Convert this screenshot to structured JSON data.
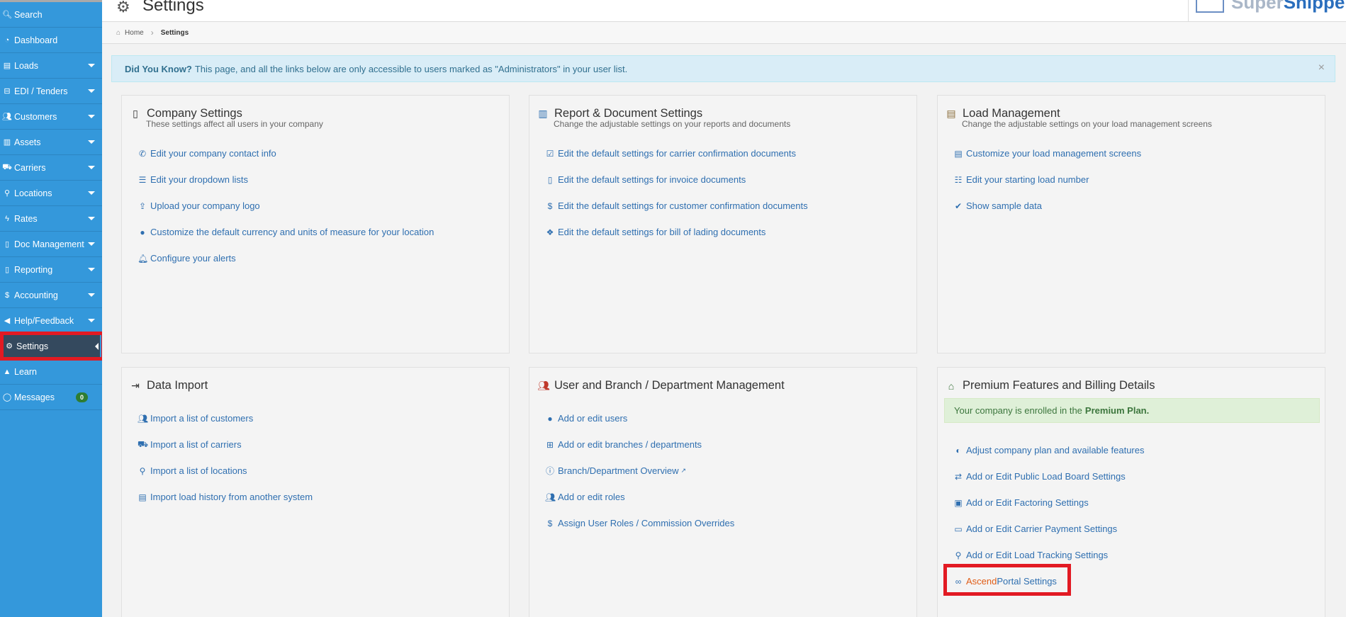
{
  "sidebar": {
    "items": [
      {
        "label": "Search",
        "icon": "search-icon",
        "glyph": "🔍︎"
      },
      {
        "label": "Dashboard",
        "icon": "dashboard-icon",
        "glyph": "◔"
      },
      {
        "label": "Loads",
        "icon": "list-icon",
        "glyph": "▤"
      },
      {
        "label": "EDI / Tenders",
        "icon": "inbox-icon",
        "glyph": "⊟"
      },
      {
        "label": "Customers",
        "icon": "users-icon",
        "glyph": "👥︎"
      },
      {
        "label": "Assets",
        "icon": "barcode-icon",
        "glyph": "▥"
      },
      {
        "label": "Carriers",
        "icon": "truck-icon",
        "glyph": "⛟"
      },
      {
        "label": "Locations",
        "icon": "map-marker-icon",
        "glyph": "⚲"
      },
      {
        "label": "Rates",
        "icon": "bolt-icon",
        "glyph": "ϟ"
      },
      {
        "label": "Doc Management",
        "icon": "document-icon",
        "glyph": "▯"
      },
      {
        "label": "Reporting",
        "icon": "report-icon",
        "glyph": "▯"
      },
      {
        "label": "Accounting",
        "icon": "dollar-icon",
        "glyph": "$"
      },
      {
        "label": "Help/Feedback",
        "icon": "bullhorn-icon",
        "glyph": "◀"
      },
      {
        "label": "Settings",
        "icon": "cogs-icon",
        "glyph": "⚙"
      },
      {
        "label": "Learn",
        "icon": "graduation-cap-icon",
        "glyph": "▲"
      },
      {
        "label": "Messages",
        "icon": "chat-icon",
        "glyph": "◯",
        "badge": "0"
      }
    ]
  },
  "header": {
    "title": "Settings",
    "logo_text_a": "Super",
    "logo_text_b": "Shipper"
  },
  "breadcrumb": {
    "home": "Home",
    "current": "Settings"
  },
  "alert": {
    "bold": "Did You Know?",
    "text": "This page, and all the links below are only accessible to users marked as \"Administrators\" in your user list."
  },
  "panels": {
    "company": {
      "title": "Company Settings",
      "subtitle": "These settings affect all users in your company",
      "links": [
        "Edit your company contact info",
        "Edit your dropdown lists",
        "Upload your company logo",
        "Customize the default currency and units of measure for your location",
        "Configure your alerts"
      ]
    },
    "report": {
      "title": "Report & Document Settings",
      "subtitle": "Change the adjustable settings on your reports and documents",
      "links": [
        "Edit the default settings for carrier confirmation documents",
        "Edit the default settings for invoice documents",
        "Edit the default settings for customer confirmation documents",
        "Edit the default settings for bill of lading documents"
      ]
    },
    "load": {
      "title": "Load Management",
      "subtitle": "Change the adjustable settings on your load management screens",
      "links": [
        "Customize your load management screens",
        "Edit your starting load number",
        "Show sample data"
      ]
    },
    "import": {
      "title": "Data Import",
      "links": [
        "Import a list of customers",
        "Import a list of carriers",
        "Import a list of locations",
        "Import load history from another system"
      ]
    },
    "users": {
      "title": "User and Branch / Department Management",
      "links": [
        "Add or edit users",
        "Add or edit branches / departments",
        "Branch/Department Overview",
        "Add or edit roles",
        "Assign User Roles / Commission Overrides"
      ]
    },
    "premium": {
      "title": "Premium Features and Billing Details",
      "enrolled_text": "Your company is enrolled in the",
      "plan": "Premium Plan.",
      "links": [
        "Adjust company plan and available features",
        "Add or Edit Public Load Board Settings",
        "Add or Edit Factoring Settings",
        "Add or Edit Carrier Payment Settings",
        "Add or Edit Load Tracking Settings"
      ],
      "ascend_a": "Ascend",
      "ascend_b": "Portal Settings"
    }
  },
  "colors": {
    "sidebar": "#3498db",
    "active": "#34495e",
    "link": "#2f6fb0",
    "highlight": "#e21a23",
    "ascend": "#e05d17"
  }
}
